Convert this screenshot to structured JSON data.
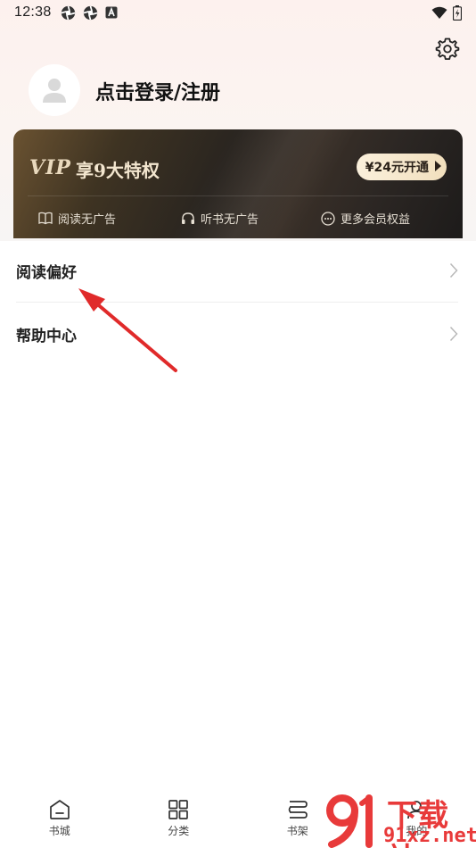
{
  "status_bar": {
    "time": "12:38",
    "left_icons": [
      "aperture-icon",
      "aperture-icon",
      "a-badge-icon"
    ],
    "right_icons": [
      "wifi-icon",
      "battery-charging-icon"
    ]
  },
  "profile": {
    "login_label": "点击登录/注册"
  },
  "vip_card": {
    "logo": "VIP",
    "title": "享9大特权",
    "open_button": "¥24元开通",
    "perks": [
      {
        "icon": "book-icon",
        "label": "阅读无广告"
      },
      {
        "icon": "headphones-icon",
        "label": "听书无广告"
      },
      {
        "icon": "more-circle-icon",
        "label": "更多会员权益"
      }
    ],
    "colors": {
      "text_gold": "#f3e6cf",
      "button_bg": "#f6e6c8"
    }
  },
  "menu": {
    "items": [
      {
        "label": "阅读偏好"
      },
      {
        "label": "帮助中心"
      }
    ]
  },
  "annotation": {
    "color": "#e02a2a"
  },
  "bottom_nav": {
    "items": [
      {
        "label": "书城",
        "icon": "home-icon"
      },
      {
        "label": "分类",
        "icon": "grid-icon"
      },
      {
        "label": "书架",
        "icon": "bookshelf-icon"
      },
      {
        "label": "我的",
        "icon": "user-icon"
      }
    ]
  },
  "watermark": {
    "top": "下载站",
    "bottom": "91xz.net",
    "color": "#e83a3a"
  }
}
